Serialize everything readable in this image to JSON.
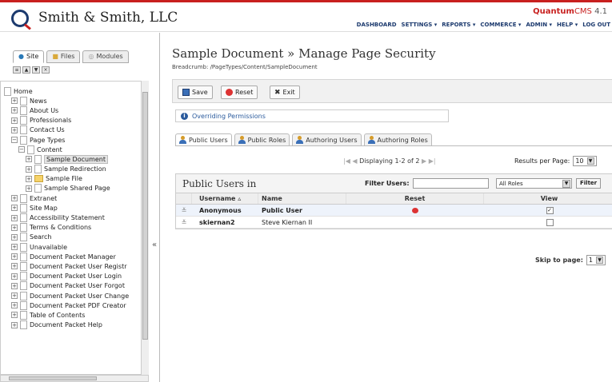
{
  "brand": {
    "name": "Smith & Smith, LLC"
  },
  "cms": {
    "prefix": "Quantum",
    "suffix": "CMS",
    "version": "4.1"
  },
  "topnav": [
    "DASHBOARD",
    "SETTINGS ▾",
    "REPORTS ▾",
    "COMMERCE ▾",
    "ADMIN ▾",
    "HELP ▾",
    "LOG OUT"
  ],
  "sidebar": {
    "tabs": [
      "Site",
      "Files",
      "Modules"
    ],
    "tools": [
      "≡",
      "▲",
      "▼",
      "×"
    ],
    "collapse": "«",
    "tree": [
      {
        "label": "Home",
        "level": 0,
        "exp": "",
        "icon": "doc"
      },
      {
        "label": "News",
        "level": 1,
        "exp": "+",
        "icon": "doc"
      },
      {
        "label": "About Us",
        "level": 1,
        "exp": "+",
        "icon": "doc"
      },
      {
        "label": "Professionals",
        "level": 1,
        "exp": "+",
        "icon": "doc"
      },
      {
        "label": "Contact Us",
        "level": 1,
        "exp": "+",
        "icon": "doc"
      },
      {
        "label": "Page Types",
        "level": 1,
        "exp": "−",
        "icon": "doc"
      },
      {
        "label": "Content",
        "level": 2,
        "exp": "−",
        "icon": "doc"
      },
      {
        "label": "Sample Document",
        "level": 3,
        "exp": "+",
        "icon": "doc",
        "selected": true
      },
      {
        "label": "Sample Redirection",
        "level": 3,
        "exp": "+",
        "icon": "doc"
      },
      {
        "label": "Sample File",
        "level": 3,
        "exp": "+",
        "icon": "folder"
      },
      {
        "label": "Sample Shared Page",
        "level": 3,
        "exp": "+",
        "icon": "doc"
      },
      {
        "label": "Extranet",
        "level": 1,
        "exp": "+",
        "icon": "doc"
      },
      {
        "label": "Site Map",
        "level": 1,
        "exp": "+",
        "icon": "doc"
      },
      {
        "label": "Accessibility Statement",
        "level": 1,
        "exp": "+",
        "icon": "doc"
      },
      {
        "label": "Terms & Conditions",
        "level": 1,
        "exp": "+",
        "icon": "doc"
      },
      {
        "label": "Search",
        "level": 1,
        "exp": "+",
        "icon": "doc"
      },
      {
        "label": "Unavailable",
        "level": 1,
        "exp": "+",
        "icon": "doc"
      },
      {
        "label": "Document Packet Manager",
        "level": 1,
        "exp": "+",
        "icon": "doc"
      },
      {
        "label": "Document Packet User Registr",
        "level": 1,
        "exp": "+",
        "icon": "doc"
      },
      {
        "label": "Document Packet User Login",
        "level": 1,
        "exp": "+",
        "icon": "doc"
      },
      {
        "label": "Document Packet User Forgot",
        "level": 1,
        "exp": "+",
        "icon": "doc"
      },
      {
        "label": "Document Packet User Change",
        "level": 1,
        "exp": "+",
        "icon": "doc"
      },
      {
        "label": "Document Packet PDF Creator",
        "level": 1,
        "exp": "+",
        "icon": "doc"
      },
      {
        "label": "Table of Contents",
        "level": 1,
        "exp": "+",
        "icon": "doc"
      },
      {
        "label": "Document Packet Help",
        "level": 1,
        "exp": "+",
        "icon": "doc"
      }
    ]
  },
  "main": {
    "title": "Sample Document » Manage Page Security",
    "breadcrumb": "Breadcrumb: /PageTypes/Content/SampleDocument",
    "toolbar": {
      "save": "Save",
      "reset": "Reset",
      "exit": "Exit"
    },
    "override": "Overriding Permissions",
    "tabs": [
      "Public Users",
      "Public Roles",
      "Authoring Users",
      "Authoring Roles"
    ],
    "pager": {
      "text": "Displaying 1-2 of 2",
      "first": "|◀",
      "prev": "◀",
      "next": "▶",
      "last": "▶|"
    },
    "results_per_page": {
      "label": "Results per Page:",
      "value": "10"
    },
    "grid": {
      "title": "Public Users in",
      "filter_label": "Filter Users:",
      "filter_value": "",
      "roles_value": "All Roles",
      "filter_button": "Filter",
      "columns": [
        "Username ▵",
        "Name",
        "Reset",
        "View"
      ],
      "rows": [
        {
          "username": "Anonymous",
          "name": "Public User",
          "reset": true,
          "view": true
        },
        {
          "username": "skiernan2",
          "name": "Steve Kiernan II",
          "reset": false,
          "view": false
        }
      ]
    },
    "skip": {
      "label": "Skip to page:",
      "value": "1"
    }
  }
}
